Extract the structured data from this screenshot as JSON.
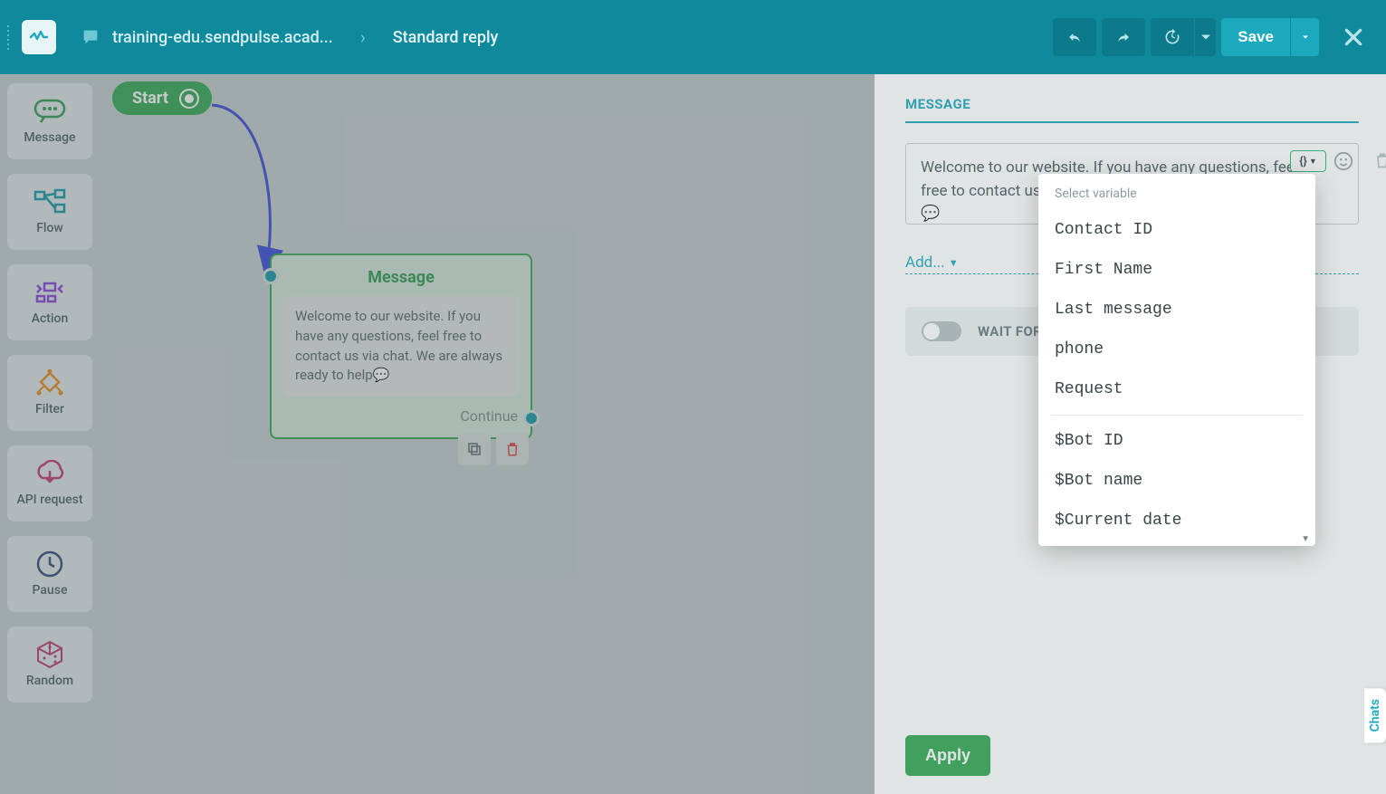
{
  "header": {
    "breadcrumb": "training-edu.sendpulse.acad...",
    "flow_name": "Standard reply",
    "save_label": "Save"
  },
  "palette": {
    "items": [
      {
        "label": "Message"
      },
      {
        "label": "Flow"
      },
      {
        "label": "Action"
      },
      {
        "label": "Filter"
      },
      {
        "label": "API request"
      },
      {
        "label": "Pause"
      },
      {
        "label": "Random"
      }
    ]
  },
  "canvas": {
    "start_label": "Start",
    "message_node": {
      "title": "Message",
      "body": "Welcome to our website. If you have any questions, feel free to contact us via chat. We are always ready to help💬",
      "continue": "Continue"
    }
  },
  "panel": {
    "title": "MESSAGE",
    "textarea_value": "Welcome to our website. If you have any questions, feel free to contact us via chat. We are always ready to help💬",
    "add_label": "Add...",
    "wait_label": "WAIT FOR THE",
    "apply_label": "Apply"
  },
  "var_dropdown": {
    "heading": "Select variable",
    "group1": [
      "Contact ID",
      "First Name",
      "Last message",
      "phone",
      "Request"
    ],
    "group2": [
      "$Bot ID",
      "$Bot name",
      "$Current date"
    ]
  },
  "chats_tab": "Chats"
}
